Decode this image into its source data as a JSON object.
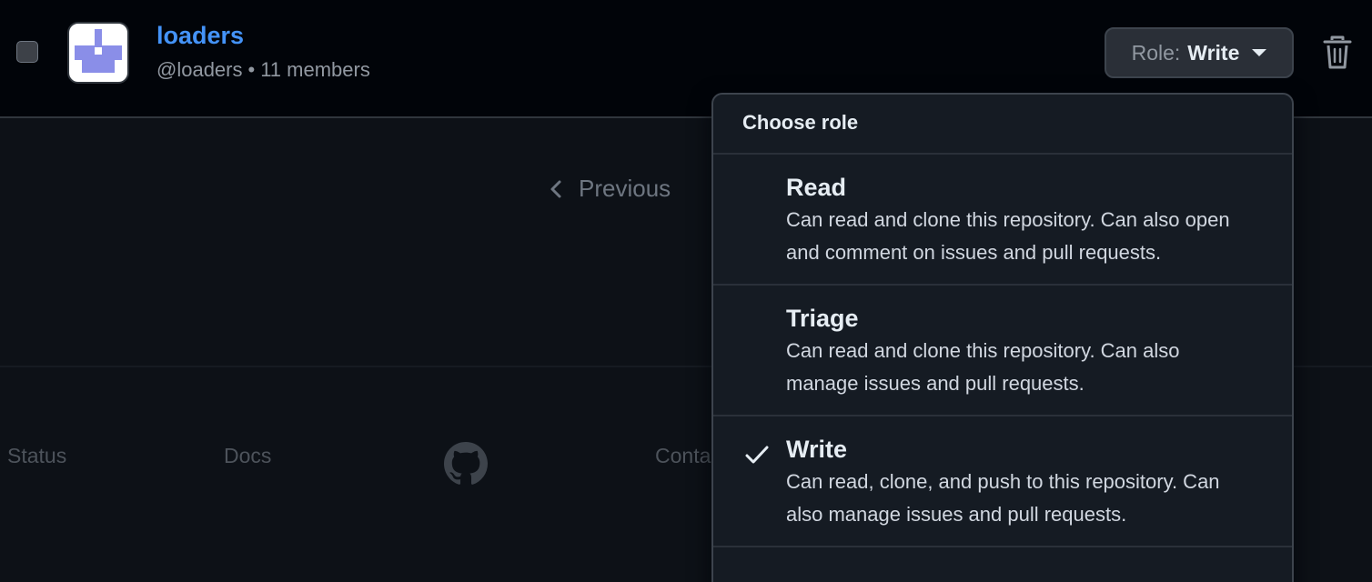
{
  "team": {
    "name": "loaders",
    "handle": "@loaders",
    "separator": "•",
    "members": "11 members",
    "role_prefix": "Role:",
    "role_value": "Write"
  },
  "pagination": {
    "previous_label": "Previous"
  },
  "footer": {
    "links": [
      "Status",
      "Docs",
      "Conta"
    ]
  },
  "role_menu": {
    "header": "Choose role",
    "items": [
      {
        "title": "Read",
        "description": "Can read and clone this repository. Can also open and comment on issues and pull requests.",
        "selected": false
      },
      {
        "title": "Triage",
        "description": "Can read and clone this repository. Can also manage issues and pull requests.",
        "selected": false
      },
      {
        "title": "Write",
        "description": "Can read, clone, and push to this repository. Can also manage issues and pull requests.",
        "selected": true
      }
    ]
  },
  "colors": {
    "background": "#0d1117",
    "link": "#4493f8",
    "avatar_accent": "#8a8ee8"
  },
  "icons": [
    "checkbox",
    "team-avatar",
    "caret-down-icon",
    "trash-icon",
    "chevron-left-icon",
    "github-logo-icon",
    "check-icon"
  ]
}
